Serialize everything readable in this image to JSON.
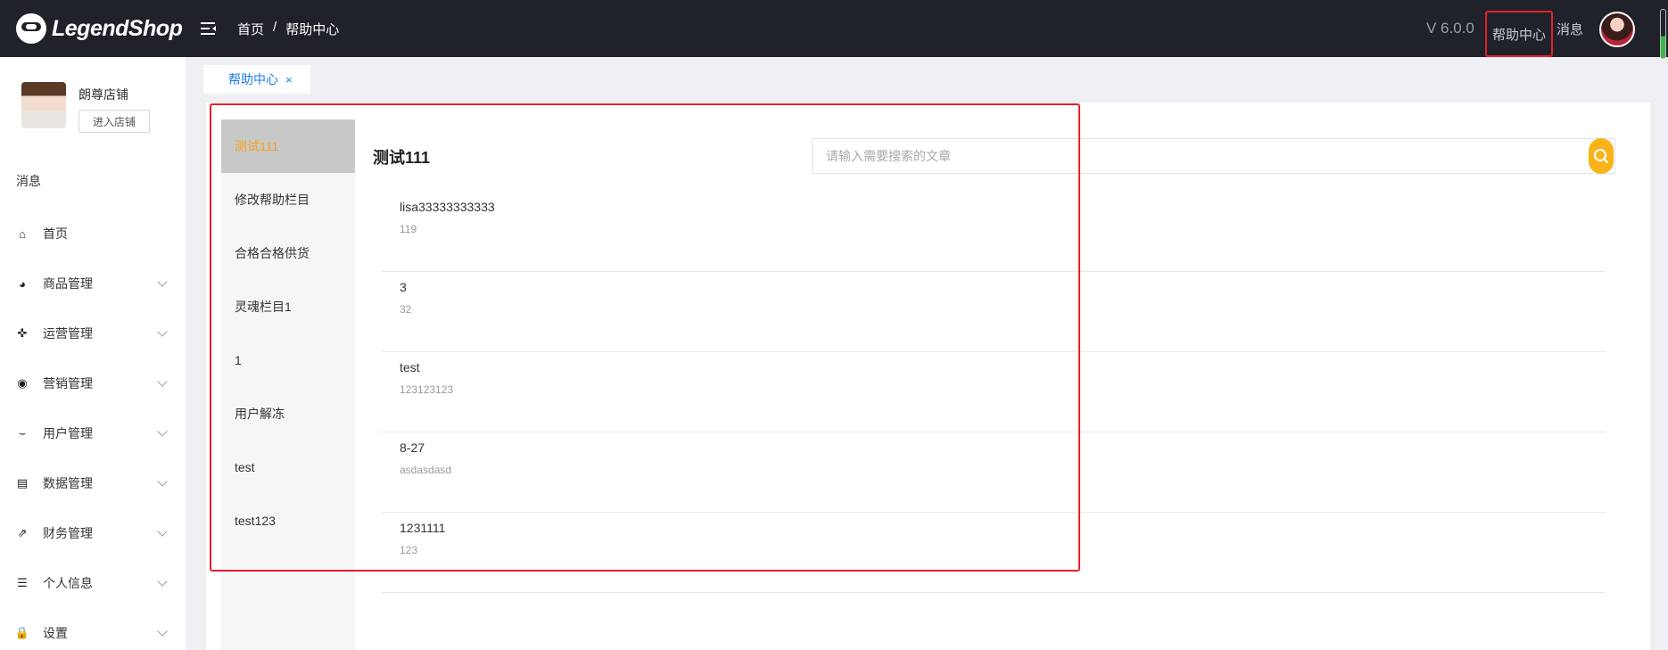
{
  "header": {
    "logo_text": "LegendShop",
    "breadcrumb": [
      "首页",
      "/",
      "帮助中心"
    ],
    "version": "V 6.0.0",
    "help_label": "帮助中心",
    "message_label": "消息"
  },
  "sidebar": {
    "shop_name": "朗尊店铺",
    "enter_shop_label": "进入店铺",
    "message_label": "消息",
    "items": [
      {
        "label": "首页",
        "icon": "home-icon",
        "glyph": "⌂"
      },
      {
        "label": "商品管理",
        "icon": "dashboard-icon",
        "glyph": "◕"
      },
      {
        "label": "运营管理",
        "icon": "crosshair-icon",
        "glyph": "✜"
      },
      {
        "label": "营销管理",
        "icon": "eye-icon",
        "glyph": "◉"
      },
      {
        "label": "用户管理",
        "icon": "eye-closed-icon",
        "glyph": "⌣"
      },
      {
        "label": "数据管理",
        "icon": "document-icon",
        "glyph": "▤"
      },
      {
        "label": "财务管理",
        "icon": "external-link-icon",
        "glyph": "⇗"
      },
      {
        "label": "个人信息",
        "icon": "list-icon",
        "glyph": "☰"
      },
      {
        "label": "设置",
        "icon": "lock-icon",
        "glyph": "🔒"
      }
    ]
  },
  "tabs": [
    {
      "label": "帮助中心",
      "close": "×"
    }
  ],
  "main": {
    "section_title": "测试111",
    "search_placeholder": "请输入需要搜索的文章",
    "categories": [
      "测试111",
      "修改帮助栏目",
      "合格合格供货",
      "灵魂栏目1",
      "1",
      "用户解冻",
      "test",
      "test123"
    ],
    "active_category": 0,
    "articles": [
      {
        "title": "lisa33333333333",
        "sub": "119"
      },
      {
        "title": "3",
        "sub": "32"
      },
      {
        "title": "test",
        "sub": "123123123"
      },
      {
        "title": "8-27",
        "sub": "asdasdasd"
      },
      {
        "title": "1231111",
        "sub": "123"
      }
    ]
  },
  "colors": {
    "topbar_bg": "#20222a",
    "accent_blue": "#1e7bf0",
    "accent_orange": "#f7a21b",
    "search_button": "#f7b318",
    "highlight_red": "#e5202a"
  }
}
